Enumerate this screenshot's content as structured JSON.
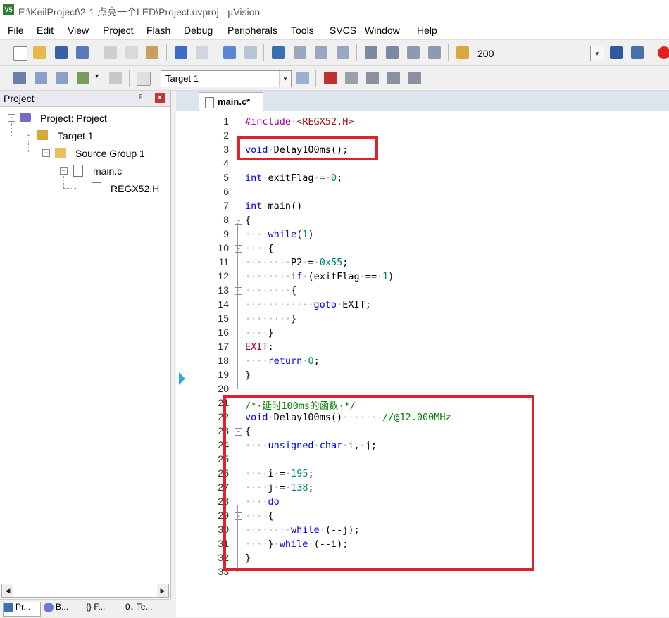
{
  "window": {
    "title": "E:\\KeilProject\\2-1 点亮一个LED\\Project.uvproj - µVision",
    "app_icon_text": "V5"
  },
  "menu": [
    "File",
    "Edit",
    "View",
    "Project",
    "Flash",
    "Debug",
    "Peripherals",
    "Tools",
    "SVCS",
    "Window",
    "Help"
  ],
  "toolbar": {
    "zoom_value": "200",
    "target_select": "Target 1"
  },
  "project_panel": {
    "title": "Project",
    "pin_symbol": "ᵖ",
    "close_symbol": "×",
    "tree": [
      {
        "label": "Project: Project",
        "level": 0
      },
      {
        "label": "Target 1",
        "level": 1
      },
      {
        "label": "Source Group 1",
        "level": 2
      },
      {
        "label": "main.c",
        "level": 3
      },
      {
        "label": "REGX52.H",
        "level": 4
      }
    ],
    "bottom_tabs": [
      "Pr...",
      "B...",
      "{} F...",
      "0↓ Te..."
    ]
  },
  "editor": {
    "tab_label": "main.c*",
    "lines": [
      {
        "n": "1",
        "code": "#include <REGX52.H>"
      },
      {
        "n": "2",
        "code": ""
      },
      {
        "n": "3",
        "code": "void Delay100ms();"
      },
      {
        "n": "4",
        "code": ""
      },
      {
        "n": "5",
        "code": "int exitFlag = 0;"
      },
      {
        "n": "6",
        "code": ""
      },
      {
        "n": "7",
        "code": "int main()"
      },
      {
        "n": "8",
        "code": "{"
      },
      {
        "n": "9",
        "code": "    while(1)"
      },
      {
        "n": "10",
        "code": "    {"
      },
      {
        "n": "11",
        "code": "        P2 = 0x55;"
      },
      {
        "n": "12",
        "code": "        if (exitFlag == 1)"
      },
      {
        "n": "13",
        "code": "        {"
      },
      {
        "n": "14",
        "code": "            goto EXIT;"
      },
      {
        "n": "15",
        "code": "        }"
      },
      {
        "n": "16",
        "code": "    }"
      },
      {
        "n": "17",
        "code": "EXIT:"
      },
      {
        "n": "18",
        "code": "    return 0;"
      },
      {
        "n": "19",
        "code": "}"
      },
      {
        "n": "20",
        "code": ""
      },
      {
        "n": "21",
        "code": "/* 延时100ms的函数 */"
      },
      {
        "n": "22",
        "code": "void Delay100ms()       //@12.000MHz"
      },
      {
        "n": "23",
        "code": "{"
      },
      {
        "n": "24",
        "code": "    unsigned char i, j;"
      },
      {
        "n": "25",
        "code": ""
      },
      {
        "n": "26",
        "code": "    i = 195;"
      },
      {
        "n": "27",
        "code": "    j = 138;"
      },
      {
        "n": "28",
        "code": "    do"
      },
      {
        "n": "29",
        "code": "    {"
      },
      {
        "n": "30",
        "code": "        while (--j);"
      },
      {
        "n": "31",
        "code": "    } while (--i);"
      },
      {
        "n": "32",
        "code": "}"
      },
      {
        "n": "33",
        "code": ""
      }
    ],
    "fold_lines": [
      "8",
      "10",
      "13",
      "23",
      "29"
    ]
  },
  "colors": {
    "highlight_box": "#e0202a",
    "keyword": "#0000ff",
    "number": "#008080",
    "comment": "#008000",
    "preprocessor": "#a000a0"
  }
}
